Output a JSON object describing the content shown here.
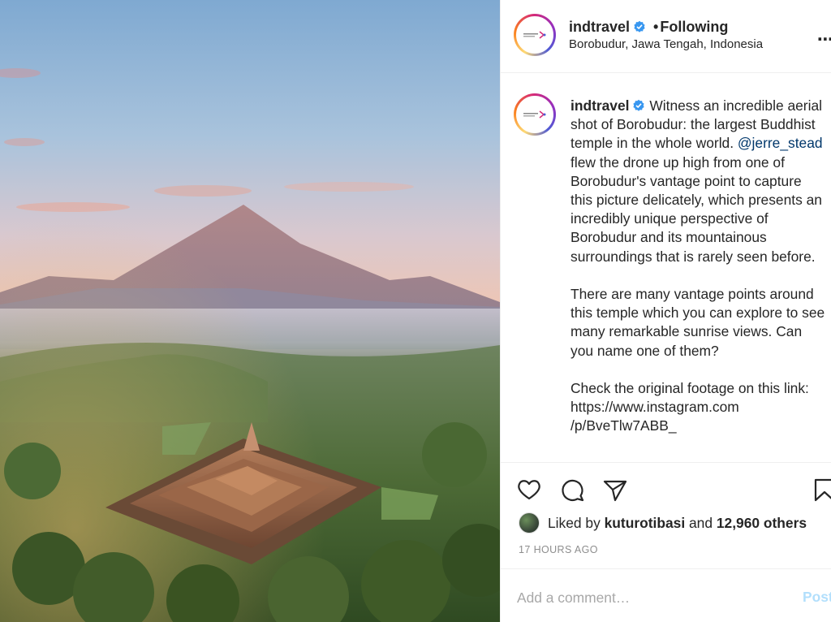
{
  "post": {
    "image_alt": "Aerial view of Borobudur temple with a volcano behind",
    "header": {
      "username": "indtravel",
      "separator": "•",
      "follow_status": "Following",
      "location": "Borobudur, Jawa Tengah, Indonesia",
      "more_icon": "⋯"
    },
    "caption": {
      "username": "indtravel",
      "text_before_mention": "Witness an incredible aerial shot of Borobudur: the largest Buddhist temple in the whole world.",
      "mention": "@jerre_stead",
      "text_after_mention": "flew the drone up high from one of Borobudur's vantage point to capture this picture delicately, which presents an incredibly unique perspective of Borobudur and its mountainous surroundings that is rarely seen before.",
      "paragraph_2": "There are many vantage points around this temple which you can explore to see many remarkable sunrise views. Can you name one of them?",
      "paragraph_3_line1": "Check the original footage on this link:",
      "paragraph_3_line2": "https://www.instagram.com",
      "paragraph_3_line3": "/p/BveTlw7ABB_"
    },
    "actions": {
      "like_icon": "heart-icon",
      "comment_icon": "comment-icon",
      "share_icon": "share-icon",
      "save_icon": "bookmark-icon"
    },
    "likes": {
      "prefix": "Liked by",
      "user": "kuturotibasi",
      "conjunction": "and",
      "others": "12,960 others"
    },
    "timestamp": "17 HOURS AGO",
    "comment": {
      "placeholder": "Add a comment…",
      "post_label": "Post"
    }
  },
  "colors": {
    "text": "#262626",
    "muted": "#8e8e8e",
    "link": "#00376b",
    "verified": "#3897f0",
    "post_disabled": "#b2dffc"
  }
}
